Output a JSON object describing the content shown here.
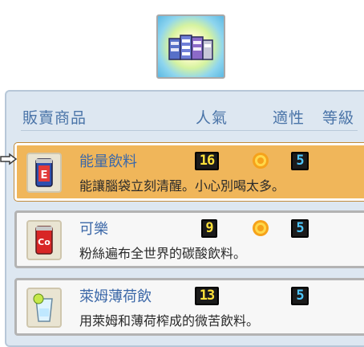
{
  "shop": {
    "icon": "drink-cans-icon"
  },
  "header": {
    "col_item": "販賣商品",
    "col_popularity": "人氣",
    "col_suitability": "適性",
    "col_level": "等級"
  },
  "items": [
    {
      "name": "能量飲料",
      "description": "能讓腦袋立刻清醒。小心別喝太多。",
      "popularity": "16",
      "suitability": "sun-icon",
      "level": "5",
      "icon": "energy-drink-can-icon",
      "selected": true
    },
    {
      "name": "可樂",
      "description": "粉絲遍布全世界的碳酸飲料。",
      "popularity": "9",
      "suitability": "sun-icon",
      "level": "5",
      "icon": "cola-can-icon",
      "selected": false
    },
    {
      "name": "萊姆薄荷飲",
      "description": "用萊姆和薄荷榨成的微苦飲料。",
      "popularity": "13",
      "suitability": "",
      "level": "5",
      "icon": "lime-mint-glass-icon",
      "selected": false
    }
  ],
  "colors": {
    "selected_row": "#f0b65a",
    "name_text": "#3c68a8",
    "header_text": "#4a74a8",
    "panel": "#dde7f1",
    "popularity_digits": "#ffe23a",
    "level_digits": "#4fc8ff"
  }
}
